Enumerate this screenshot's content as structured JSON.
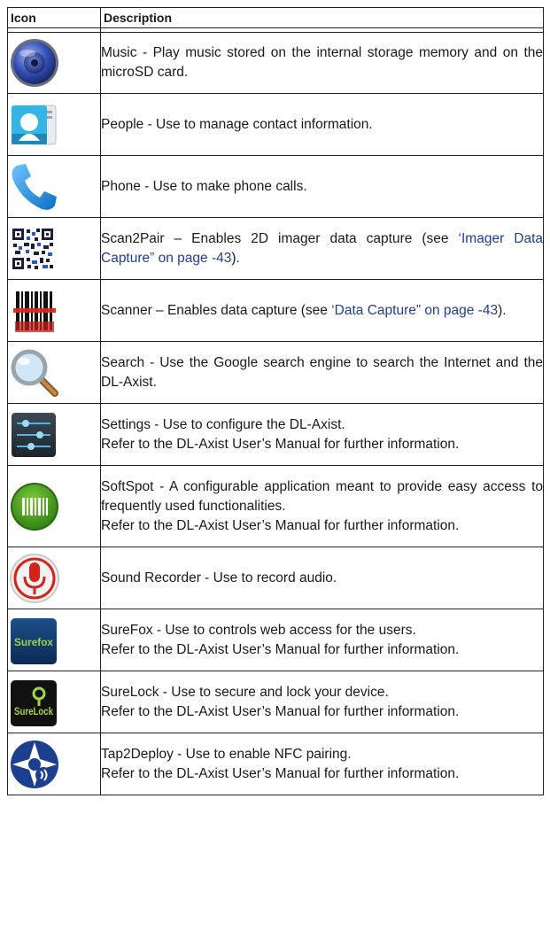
{
  "table": {
    "headers": {
      "icon": "Icon",
      "description": "Description"
    },
    "rows": [
      {
        "icon_name": "music-icon",
        "lines": [
          "Music - Play music stored on the internal storage memory and on the microSD card."
        ]
      },
      {
        "icon_name": "people-icon",
        "lines": [
          "People - Use to manage contact information."
        ]
      },
      {
        "icon_name": "phone-icon",
        "lines": [
          "Phone - Use to make phone calls."
        ]
      },
      {
        "icon_name": "scan2pair-icon",
        "text_before": "Scan2Pair – Enables 2D imager data capture (see ",
        "link": "‘Imager Data Capture” on page -43",
        "text_after": ")."
      },
      {
        "icon_name": "scanner-icon",
        "text_before": "Scanner – Enables data capture (see ",
        "link": "‘Data Capture” on page -43",
        "text_after": ")."
      },
      {
        "icon_name": "search-icon",
        "lines": [
          "Search - Use the Google search engine to search the Internet and the DL-Axist."
        ]
      },
      {
        "icon_name": "settings-icon",
        "lines": [
          "Settings - Use to configure the DL-Axist.",
          "Refer to the DL-Axist User’s Manual for further information."
        ]
      },
      {
        "icon_name": "softspot-icon",
        "lines": [
          "SoftSpot - A configurable application meant to provide easy access to frequently used functionalities.",
          "Refer to the DL-Axist User’s Manual for further information."
        ]
      },
      {
        "icon_name": "sound-recorder-icon",
        "lines": [
          "Sound Recorder - Use to record audio."
        ]
      },
      {
        "icon_name": "surefox-icon",
        "lines": [
          "SureFox - Use to controls web access for the users.",
          "Refer to the DL-Axist User’s Manual for further information."
        ]
      },
      {
        "icon_name": "surelock-icon",
        "lines": [
          "SureLock - Use to secure and lock your device.",
          "Refer to the DL-Axist User’s Manual for further information."
        ]
      },
      {
        "icon_name": "tap2deploy-icon",
        "lines": [
          "Tap2Deploy - Use to enable NFC pairing.",
          "Refer to the DL-Axist User’s Manual for further information."
        ]
      }
    ]
  },
  "logos": {
    "surefox": "Surefox",
    "surelock": "SureLock"
  },
  "colors": {
    "link": "#1f3d9c",
    "border": "#222222"
  }
}
